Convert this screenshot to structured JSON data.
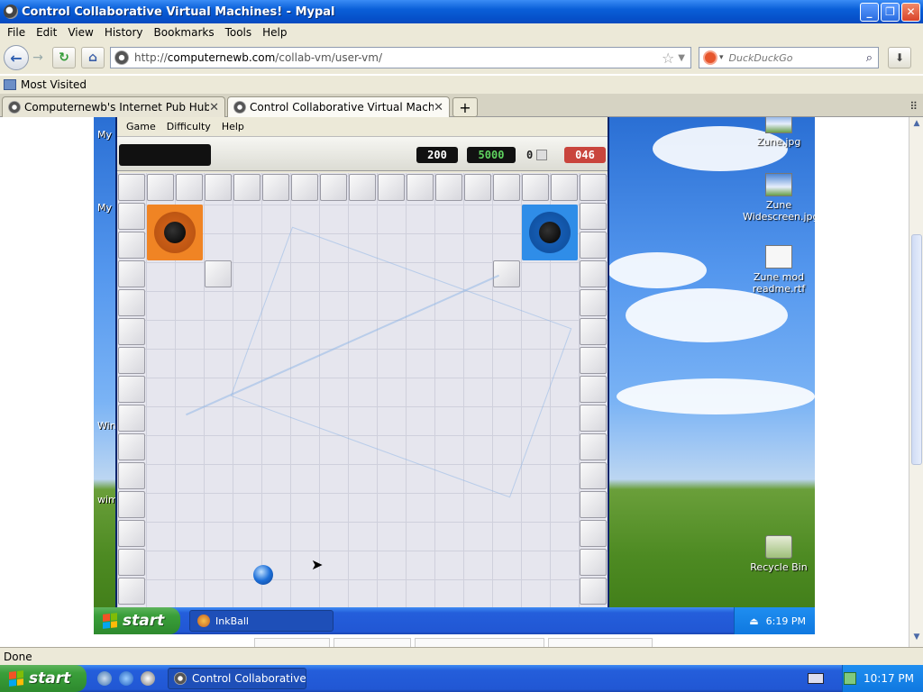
{
  "window": {
    "title": "Control Collaborative Virtual Machines! - Mypal"
  },
  "menubar": {
    "items": [
      "File",
      "Edit",
      "View",
      "History",
      "Bookmarks",
      "Tools",
      "Help"
    ]
  },
  "nav": {
    "url_prefix": "http://",
    "url_domain": "computernewb.com",
    "url_path": "/collab-vm/user-vm/",
    "search_placeholder": "DuckDuckGo"
  },
  "bookmarks": {
    "most_visited": "Most Visited"
  },
  "tabs": [
    {
      "label": "Computernewb's Internet Pub Hub"
    },
    {
      "label": "Control Collaborative Virtual Machines!"
    }
  ],
  "vm": {
    "side_labels": [
      "My",
      "My",
      "Win",
      "wim"
    ],
    "inkball": {
      "menu": [
        "Game",
        "Difficulty",
        "Help"
      ],
      "score": "200",
      "target": "5000",
      "balls": "0",
      "timer": "046"
    },
    "desktop_icons": [
      {
        "label": "Zune.jpg"
      },
      {
        "label": "Zune Widescreen.jpg"
      },
      {
        "label": "Zune mod readme.rtf"
      },
      {
        "label": "Recycle Bin"
      }
    ],
    "taskbar": {
      "start": "start",
      "task": "InkBall",
      "clock": "6:19 PM"
    }
  },
  "status": {
    "text": "Done"
  },
  "host_taskbar": {
    "start": "start",
    "task": "Control Collaborative ...",
    "clock": "10:17 PM"
  }
}
